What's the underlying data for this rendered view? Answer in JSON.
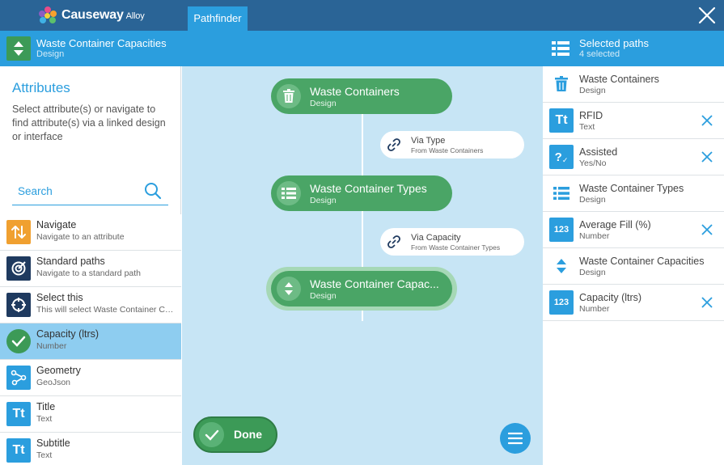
{
  "app": {
    "brand": "Causeway",
    "brand_suffix": "Alloy",
    "active_tab": "Pathfinder"
  },
  "header": {
    "title": "Waste Container Capacities",
    "subtitle": "Design",
    "selected_title": "Selected paths",
    "selected_count": "4 selected"
  },
  "attributes": {
    "title": "Attributes",
    "description": "Select attribute(s) or navigate to find attribute(s) via a linked design or interface",
    "search_placeholder": "Search",
    "items": [
      {
        "title": "Navigate",
        "sub": "Navigate to an attribute",
        "icon": "arrows-updown-icon",
        "color": "#f0a030"
      },
      {
        "title": "Standard paths",
        "sub": "Navigate to a standard path",
        "icon": "target-icon",
        "color": "#1f3a5f"
      },
      {
        "title": "Select this",
        "sub": "This will select Waste Container Capacities",
        "icon": "crosshair-icon",
        "color": "#1f3a5f"
      },
      {
        "title": "Capacity (ltrs)",
        "sub": "Number",
        "icon": "check-circle-icon",
        "color": "#3c9a57"
      },
      {
        "title": "Geometry",
        "sub": "GeoJson",
        "icon": "geometry-icon",
        "color": "#2b9ede"
      },
      {
        "title": "Title",
        "sub": "Text",
        "icon": "text-icon",
        "color": "#2b9ede"
      },
      {
        "title": "Subtitle",
        "sub": "Text",
        "icon": "text-icon",
        "color": "#2b9ede"
      }
    ]
  },
  "canvas": {
    "nodes": [
      {
        "title": "Waste Containers",
        "sub": "Design"
      },
      {
        "title": "Waste Container Types",
        "sub": "Design"
      },
      {
        "title": "Waste Container Capac...",
        "sub": "Design"
      }
    ],
    "links": [
      {
        "title": "Via Type",
        "sub": "From Waste Containers"
      },
      {
        "title": "Via Capacity",
        "sub": "From Waste Container Types"
      }
    ],
    "done_label": "Done"
  },
  "selected_paths": [
    {
      "title": "Waste Containers",
      "sub": "Design",
      "icon": "trash-icon",
      "removable": false
    },
    {
      "title": "RFID",
      "sub": "Text",
      "icon": "text-icon",
      "removable": true
    },
    {
      "title": "Assisted",
      "sub": "Yes/No",
      "icon": "question-icon",
      "removable": true
    },
    {
      "title": "Waste Container Types",
      "sub": "Design",
      "icon": "list-icon",
      "removable": false
    },
    {
      "title": "Average Fill (%)",
      "sub": "Number",
      "icon": "number-icon",
      "removable": true
    },
    {
      "title": "Waste Container Capacities",
      "sub": "Design",
      "icon": "capacity-icon",
      "removable": false
    },
    {
      "title": "Capacity (ltrs)",
      "sub": "Number",
      "icon": "number-icon",
      "removable": true
    }
  ],
  "colors": {
    "topbar": "#2a6496",
    "accent": "#2b9ede",
    "green": "#4aa566",
    "canvas": "#c7e5f5"
  }
}
